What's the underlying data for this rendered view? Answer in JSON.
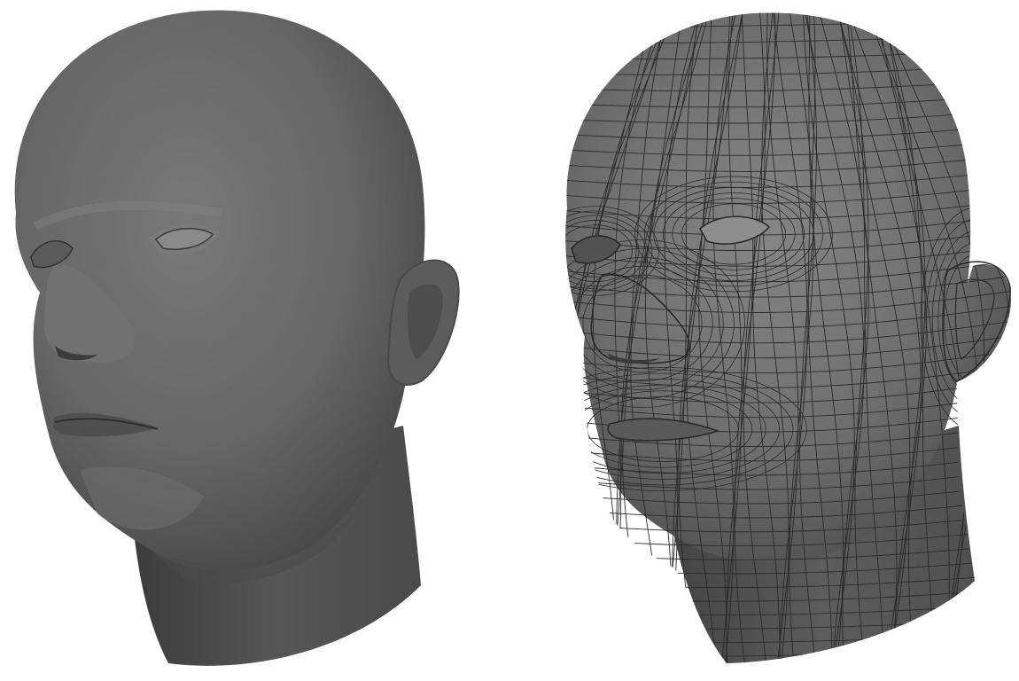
{
  "background_color": "#ffffff",
  "models": [
    {
      "id": "smooth-shaded-head",
      "shading": "smooth",
      "wireframe": false,
      "fill": "#666666",
      "highlight": "#777777",
      "shadow": "#3e3e3e"
    },
    {
      "id": "wireframe-head",
      "shading": "smooth",
      "wireframe": true,
      "fill": "#6e6e6e",
      "highlight": "#808080",
      "shadow": "#454545",
      "wire_color": "#2b2b2b"
    }
  ]
}
